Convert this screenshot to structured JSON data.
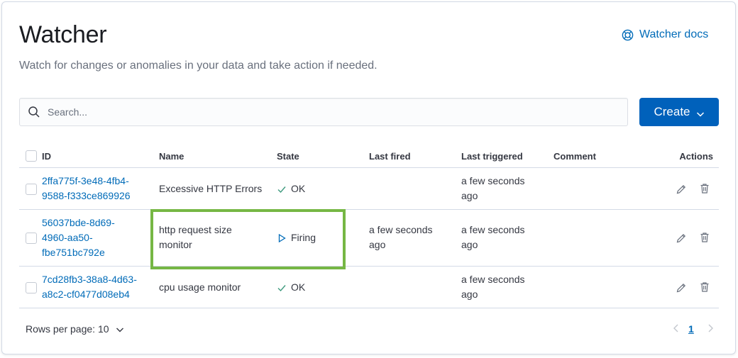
{
  "header": {
    "title": "Watcher",
    "subtitle": "Watch for changes or anomalies in your data and take action if needed.",
    "docs_link": "Watcher docs"
  },
  "toolbar": {
    "search_placeholder": "Search...",
    "create_label": "Create"
  },
  "table": {
    "columns": {
      "id": "ID",
      "name": "Name",
      "state": "State",
      "last_fired": "Last fired",
      "last_triggered": "Last triggered",
      "comment": "Comment",
      "actions": "Actions"
    },
    "rows": [
      {
        "id_lines": [
          "2ffa775f-3e48-4fb4-",
          "9588-f333ce869926"
        ],
        "name_lines": [
          "Excessive HTTP Errors"
        ],
        "state": "OK",
        "state_icon": "check-icon",
        "last_fired_lines": [],
        "last_triggered_lines": [
          "a few seconds",
          "ago"
        ],
        "comment": ""
      },
      {
        "id_lines": [
          "56037bde-8d69-",
          "4960-aa50-",
          "fbe751bc792e"
        ],
        "name_lines": [
          "http request size",
          "monitor"
        ],
        "state": "Firing",
        "state_icon": "play-icon",
        "last_fired_lines": [
          "a few seconds",
          "ago"
        ],
        "last_triggered_lines": [
          "a few seconds",
          "ago"
        ],
        "comment": ""
      },
      {
        "id_lines": [
          "7cd28fb3-38a8-4d63-",
          "a8c2-cf0477d08eb4"
        ],
        "name_lines": [
          "cpu usage monitor"
        ],
        "state": "OK",
        "state_icon": "check-icon",
        "last_fired_lines": [],
        "last_triggered_lines": [
          "a few seconds",
          "ago"
        ],
        "comment": ""
      }
    ]
  },
  "footer": {
    "rows_per_page": "Rows per page: 10",
    "current_page": "1"
  },
  "colors": {
    "link": "#006bb8",
    "primary_button": "#0061bb",
    "highlight_border": "#76b744",
    "state_ok": "#3e9a7e",
    "state_firing": "#006bb8"
  }
}
